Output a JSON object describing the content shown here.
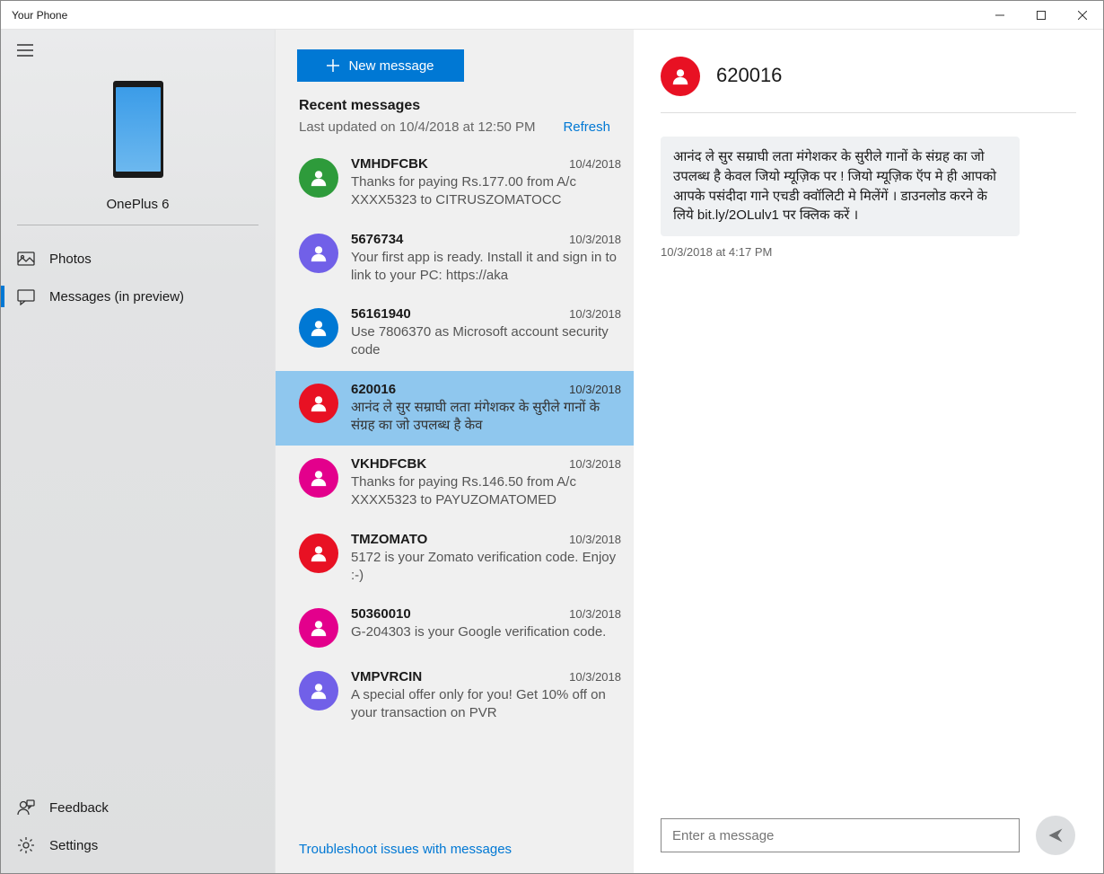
{
  "window": {
    "title": "Your Phone"
  },
  "sidebar": {
    "phone_name": "OnePlus 6",
    "nav": {
      "photos": "Photos",
      "messages": "Messages (in preview)"
    },
    "feedback": "Feedback",
    "settings": "Settings"
  },
  "mid": {
    "new_message": "New message",
    "recent_heading": "Recent messages",
    "updated": "Last updated on 10/4/2018 at 12:50 PM",
    "refresh": "Refresh",
    "troubleshoot": "Troubleshoot issues with messages",
    "messages": [
      {
        "sender": "VMHDFCBK",
        "date": "10/4/2018",
        "preview": "Thanks for paying Rs.177.00 from A/c XXXX5323 to CITRUSZOMATOCC",
        "color": "#2e9b3b",
        "selected": false
      },
      {
        "sender": "5676734",
        "date": "10/3/2018",
        "preview": "Your first app is ready. Install it and sign in to link to your PC: https://aka",
        "color": "#7160e8",
        "selected": false
      },
      {
        "sender": "56161940",
        "date": "10/3/2018",
        "preview": "Use 7806370 as Microsoft account security code",
        "color": "#0078d4",
        "selected": false
      },
      {
        "sender": "620016",
        "date": "10/3/2018",
        "preview": "आनंद ले सुर सम्राघी लता मंगेशकर के सुरीले गानों के संग्रह का जो उपलब्ध है केव",
        "color": "#e81123",
        "selected": true
      },
      {
        "sender": "VKHDFCBK",
        "date": "10/3/2018",
        "preview": "Thanks for paying Rs.146.50 from A/c XXXX5323 to PAYUZOMATOMED",
        "color": "#e3008c",
        "selected": false
      },
      {
        "sender": "TMZOMATO",
        "date": "10/3/2018",
        "preview": "5172 is your Zomato verification code. Enjoy :-)",
        "color": "#e81123",
        "selected": false
      },
      {
        "sender": "50360010",
        "date": "10/3/2018",
        "preview": "G-204303 is your Google verification code.",
        "color": "#e3008c",
        "selected": false
      },
      {
        "sender": "VMPVRCIN",
        "date": "10/3/2018",
        "preview": "A special offer only for you! Get 10% off on your transaction on PVR",
        "color": "#7160e8",
        "selected": false
      }
    ]
  },
  "convo": {
    "title": "620016",
    "avatar_color": "#e81123",
    "bubble_text": "आनंद ले सुर सम्राघी लता मंगेशकर के सुरीले गानों के संग्रह का जो उपलब्ध है केवल जियो म्यूज़िक पर ! जियो म्यूज़िक ऍप मे ही आपको आपके पसंदीदा गाने एचडी क्वॉलिटी मे मिलेंगें । डाउनलोड करने के लिये bit.ly/2OLulv1 पर क्लिक करें ।",
    "bubble_time": "10/3/2018 at 4:17 PM",
    "compose_placeholder": "Enter a message"
  }
}
